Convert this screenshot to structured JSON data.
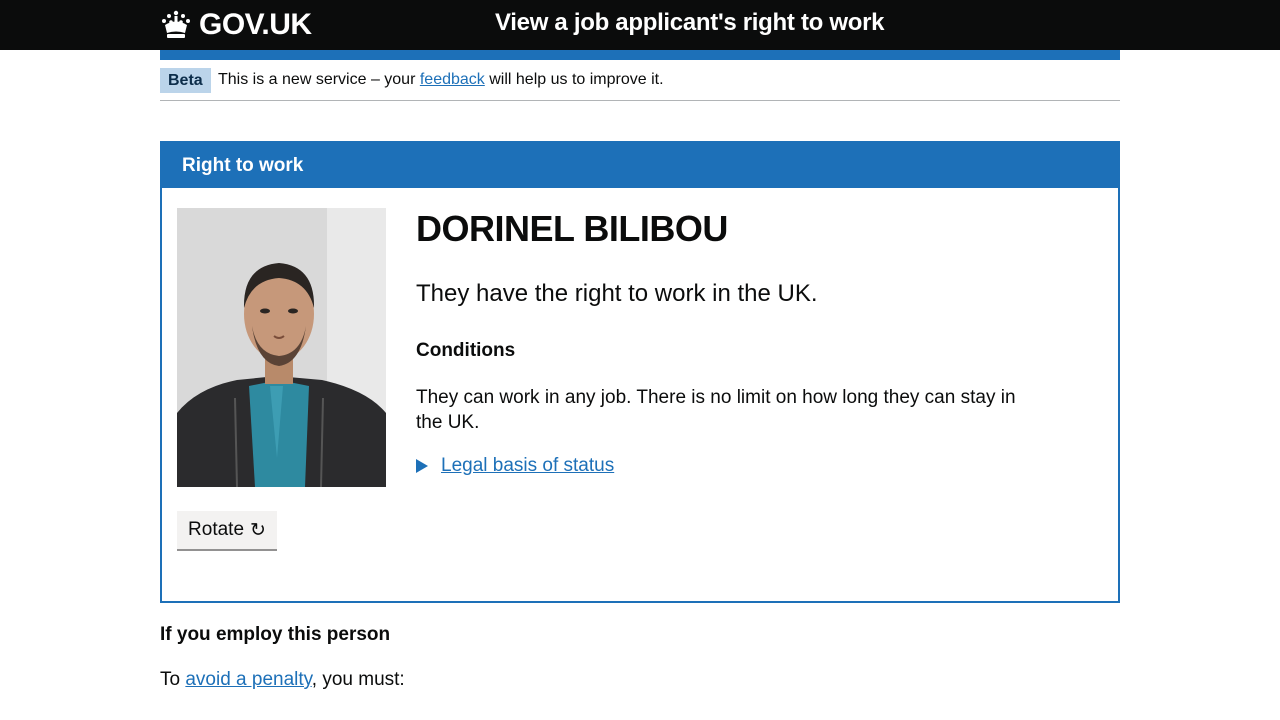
{
  "header": {
    "logo_text": "GOV.UK",
    "service_name": "View a job applicant's right to work"
  },
  "phase_banner": {
    "tag": "Beta",
    "text_before": "This is a new service – your ",
    "link": "feedback",
    "text_after": " will help us to improve it."
  },
  "panel": {
    "title": "Right to work",
    "name": "DORINEL BILIBOU",
    "status": "They have the right to work in the UK.",
    "conditions_heading": "Conditions",
    "conditions_text": "They can work in any job. There is no limit on how long they can stay in the UK.",
    "details_link": "Legal basis of status",
    "rotate_label": "Rotate",
    "rotate_icon": "↻"
  },
  "employ": {
    "heading": "If you employ this person",
    "text_before": "To ",
    "link": "avoid a penalty",
    "text_after": ", you must:"
  },
  "colors": {
    "header_bg": "#0b0c0c",
    "brand_blue": "#1d70b8",
    "link": "#1d70b8",
    "phase_tag_bg": "#bbd4ea"
  }
}
